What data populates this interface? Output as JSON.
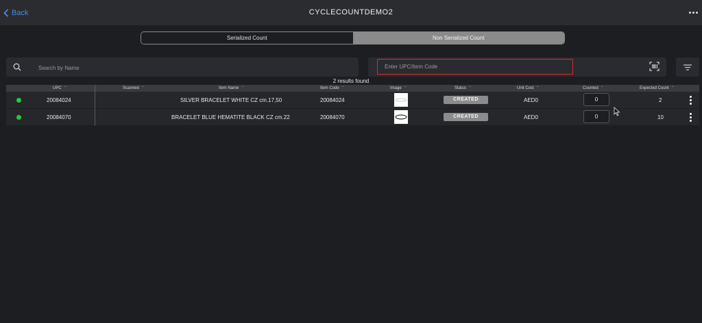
{
  "header": {
    "back_label": "Back",
    "title": "CYCLECOUNTDEMO2"
  },
  "tabs": [
    {
      "label": "Serialized Count",
      "active": false
    },
    {
      "label": "Non Serialized Count",
      "active": true
    }
  ],
  "search": {
    "placeholder": "Search by Name"
  },
  "upc": {
    "placeholder": "Enter UPC/Item Code"
  },
  "results_text": "2 results found",
  "table": {
    "columns": [
      "UPC",
      "Scanned",
      "Item Name",
      "Item Code",
      "Image",
      "Status",
      "Unit Cost",
      "Counted",
      "Expected Count"
    ],
    "rows": [
      {
        "upc": "20084024",
        "scanned": "",
        "item_name": "SILVER BRACELET WHITE CZ cm.17,50",
        "item_code": "20084024",
        "status": "CREATED",
        "unit_cost": "AED0",
        "counted": "0",
        "expected": "2"
      },
      {
        "upc": "20084070",
        "scanned": "",
        "item_name": "BRACELET BLUE HEMATITE BLACK CZ cm.22",
        "item_code": "20084070",
        "status": "CREATED",
        "unit_cost": "AED0",
        "counted": "0",
        "expected": "10"
      }
    ]
  },
  "colors": {
    "accent": "#3d8fe6",
    "status_dot": "#27c93f",
    "input_border_focus": "#d32d2d",
    "badge_bg": "#8c8c8c"
  },
  "icons": [
    "chevron-left-icon",
    "more-horizontal-icon",
    "search-icon",
    "barcode-scan-icon",
    "filter-icon",
    "kebab-icon"
  ]
}
